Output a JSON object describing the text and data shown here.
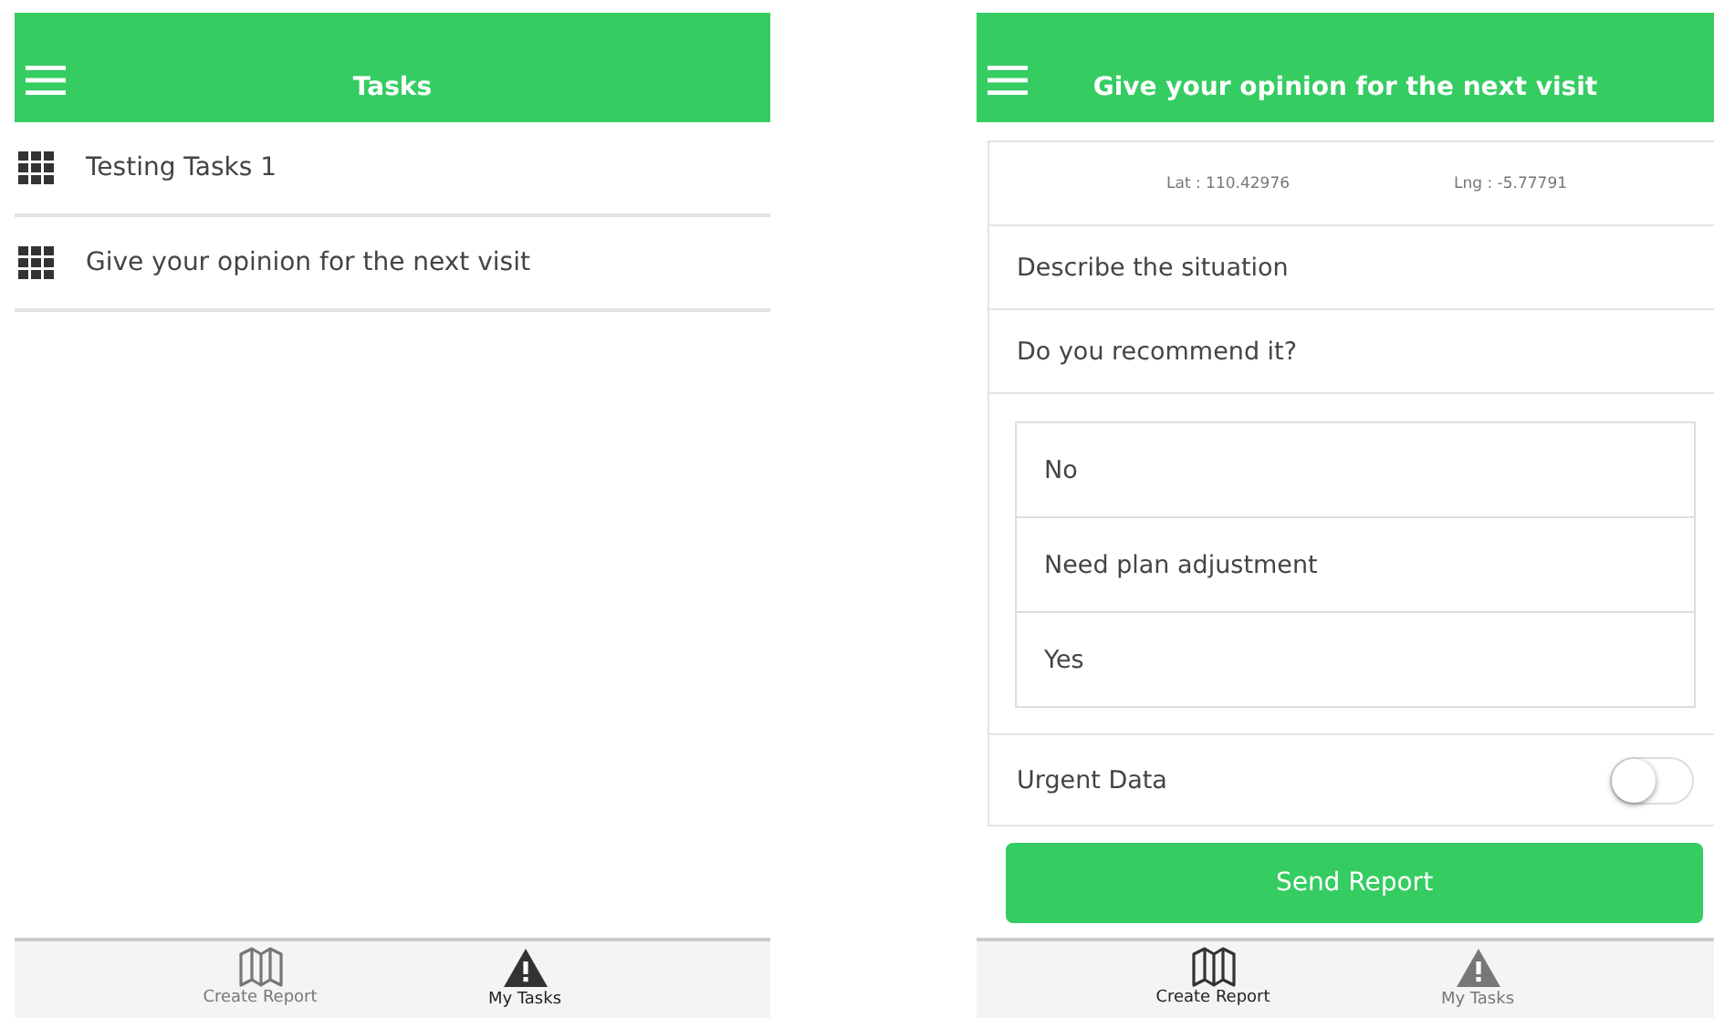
{
  "screens": [
    {
      "title": "Tasks",
      "kind": "list",
      "tasks": [
        "Testing Tasks 1",
        "Give your opinion for the next visit"
      ],
      "tabs": [
        {
          "label": "Create Report",
          "kind": "map",
          "selected": false
        },
        {
          "label": "My Tasks",
          "kind": "warning",
          "selected": true
        }
      ]
    },
    {
      "title": "Give your opinion for the next visit",
      "kind": "form",
      "lat": "Lat : 110.42976",
      "lng": "Lng : -5.77791",
      "fields": [
        "Describe the situation",
        "Do you recommend it?"
      ],
      "options": [
        "No",
        "Need plan adjustment",
        "Yes"
      ],
      "toggle": {
        "label": "Urgent Data",
        "on": false
      },
      "button": "Send Report",
      "tabs": [
        {
          "label": "Create Report",
          "kind": "map",
          "selected": true
        },
        {
          "label": "My Tasks",
          "kind": "warning",
          "selected": false
        }
      ]
    }
  ]
}
